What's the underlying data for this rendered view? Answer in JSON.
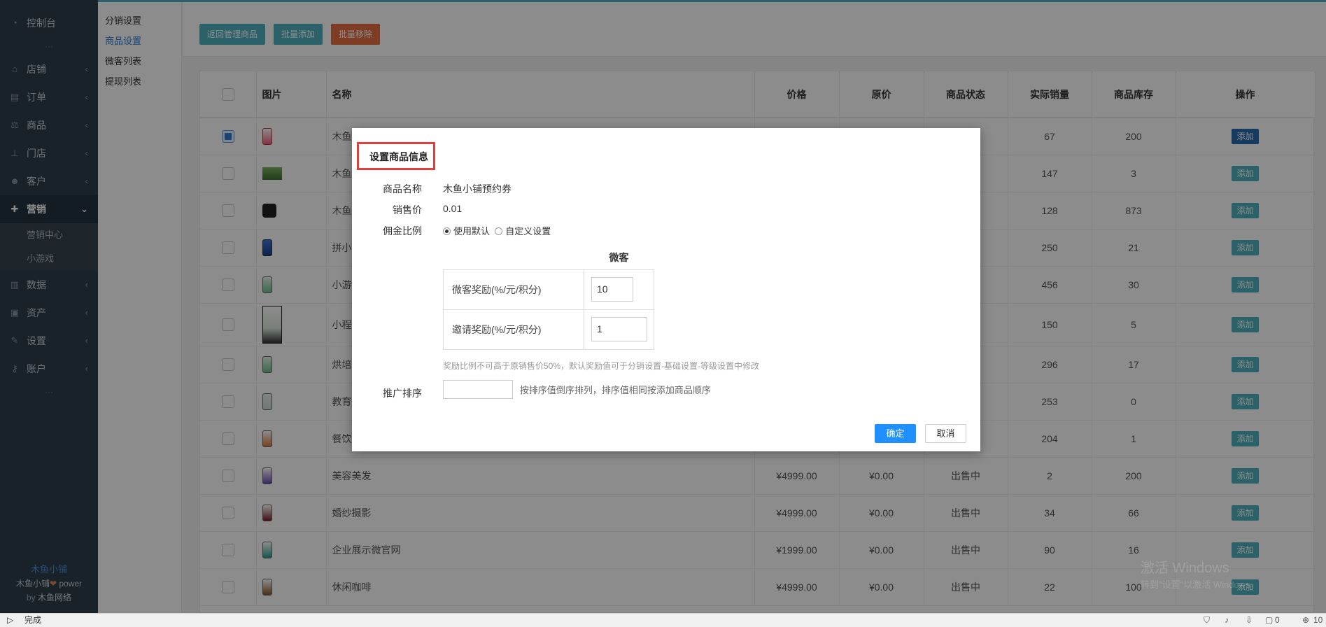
{
  "sidebar": {
    "top": "控制台",
    "items": [
      {
        "label": "店铺",
        "icon": "store-icon"
      },
      {
        "label": "订单",
        "icon": "order-icon"
      },
      {
        "label": "商品",
        "icon": "scale-icon"
      },
      {
        "label": "门店",
        "icon": "sitemap-icon"
      },
      {
        "label": "客户",
        "icon": "users-icon"
      }
    ],
    "active": "营销",
    "sub_items": [
      "营销中心",
      "小游戏"
    ],
    "items2": [
      {
        "label": "数据",
        "icon": "chart-icon"
      },
      {
        "label": "资产",
        "icon": "money-icon"
      },
      {
        "label": "设置",
        "icon": "wrench-icon"
      },
      {
        "label": "账户",
        "icon": "key-icon"
      }
    ],
    "footer": {
      "brand": "木鱼小铺",
      "power_prefix": "木鱼小铺",
      "power_suffix": "power",
      "by_prefix": "by",
      "by_name": "木鱼网络"
    }
  },
  "subnav": {
    "items": [
      "分销设置",
      "商品设置",
      "微客列表",
      "提现列表"
    ],
    "active_index": 1
  },
  "toolbar": {
    "back": "返回管理商品",
    "batch_add": "批量添加",
    "batch_remove": "批量移除"
  },
  "table": {
    "headers": {
      "image": "图片",
      "name": "名称",
      "price": "价格",
      "orig": "原价",
      "status": "商品状态",
      "sales": "实际销量",
      "stock": "商品库存",
      "action": "操作"
    },
    "action_label": "添加",
    "rows": [
      {
        "name": "木鱼",
        "price": "",
        "orig": "",
        "status": "",
        "sales": "67",
        "stock": "200"
      },
      {
        "name": "木鱼",
        "price": "",
        "orig": "",
        "status": "",
        "sales": "147",
        "stock": "3"
      },
      {
        "name": "木鱼",
        "price": "",
        "orig": "",
        "status": "",
        "sales": "128",
        "stock": "873"
      },
      {
        "name": "拼小",
        "price": "",
        "orig": "",
        "status": "",
        "sales": "250",
        "stock": "21"
      },
      {
        "name": "小游",
        "price": "",
        "orig": "",
        "status": "",
        "sales": "456",
        "stock": "30"
      },
      {
        "name": "小程",
        "price": "",
        "orig": "",
        "status": "",
        "sales": "150",
        "stock": "5"
      },
      {
        "name": "烘培",
        "price": "",
        "orig": "",
        "status": "",
        "sales": "296",
        "stock": "17"
      },
      {
        "name": "教育",
        "price": "",
        "orig": "",
        "status": "",
        "sales": "253",
        "stock": "0"
      },
      {
        "name": "餐饮",
        "price": "",
        "orig": "",
        "status": "",
        "sales": "204",
        "stock": "1"
      },
      {
        "name": "美容美发",
        "price": "¥4999.00",
        "orig": "¥0.00",
        "status": "出售中",
        "sales": "2",
        "stock": "200"
      },
      {
        "name": "婚纱摄影",
        "price": "¥4999.00",
        "orig": "¥0.00",
        "status": "出售中",
        "sales": "34",
        "stock": "66"
      },
      {
        "name": "企业展示微官网",
        "price": "¥1999.00",
        "orig": "¥0.00",
        "status": "出售中",
        "sales": "90",
        "stock": "16"
      },
      {
        "name": "休闲咖啡",
        "price": "¥4999.00",
        "orig": "¥0.00",
        "status": "出售中",
        "sales": "22",
        "stock": "100"
      }
    ]
  },
  "modal": {
    "title": "设置商品信息",
    "name_label": "商品名称",
    "name_value": "木鱼小铺预约券",
    "price_label": "销售价",
    "price_value": "0.01",
    "ratio_label": "佣金比例",
    "ratio_default": "使用默认",
    "ratio_custom": "自定义设置",
    "reward_header": "微客",
    "weike_label": "微客奖励(%/元/积分)",
    "weike_value": "10",
    "invite_label": "邀请奖励(%/元/积分)",
    "invite_value": "1",
    "hint": "奖励比例不可高于原销售价50%，默认奖励值可于分销设置-基础设置-等级设置中修改",
    "sort_label": "推广排序",
    "sort_hint": "按排序值倒序排列，排序值相同按添加商品顺序",
    "confirm": "确定",
    "cancel": "取消"
  },
  "watermark": {
    "line1": "激活 Windows",
    "line2": "转到\"设置\"以激活 Windows。"
  },
  "statusbar": {
    "status": "完成",
    "count1": "0",
    "zoom": "10"
  }
}
